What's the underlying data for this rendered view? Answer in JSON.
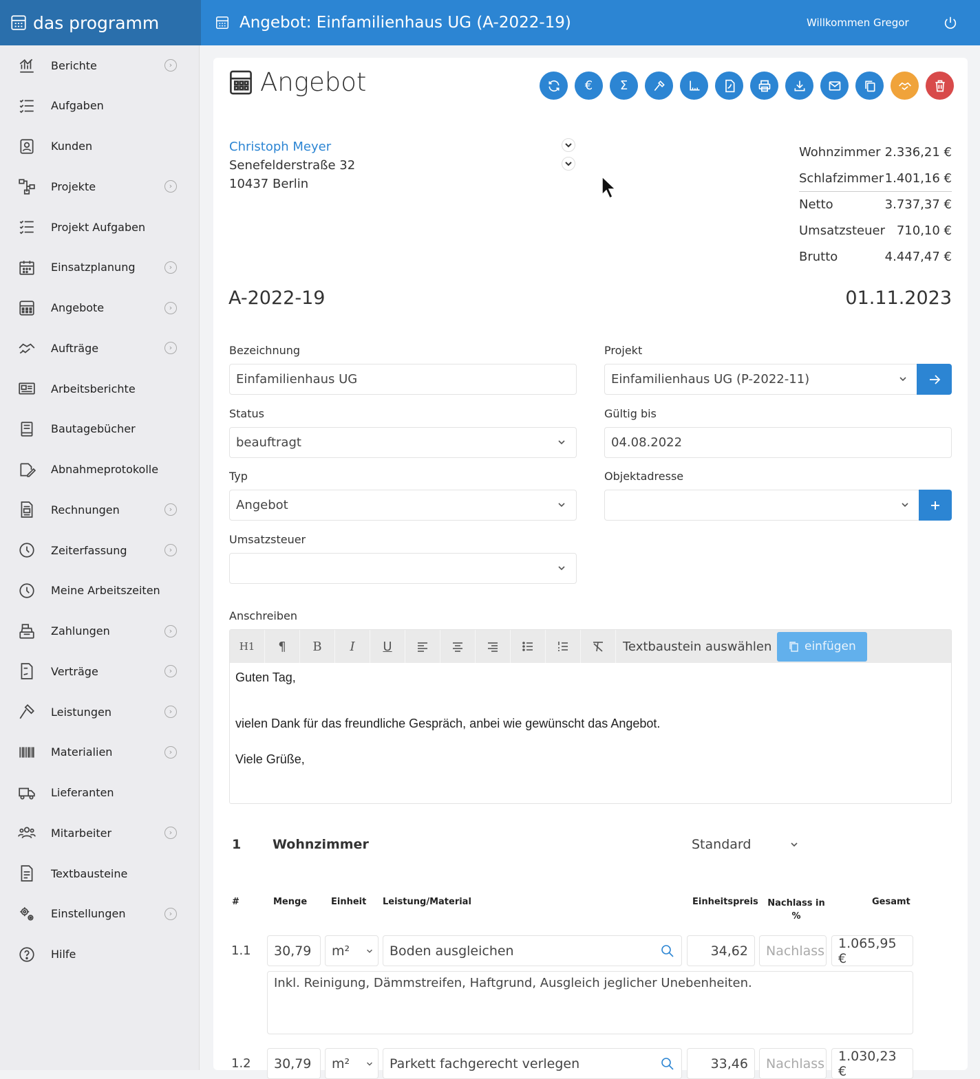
{
  "app": {
    "name": "das programm",
    "title": "Angebot: Einfamilienhaus UG (A-2022-19)",
    "welcome": "Willkommen Gregor"
  },
  "sidebar": {
    "items": [
      {
        "label": "Berichte",
        "icon": "chart-icon",
        "chevron": true
      },
      {
        "label": "Aufgaben",
        "icon": "tasks-icon",
        "chevron": false
      },
      {
        "label": "Kunden",
        "icon": "customer-icon",
        "chevron": false
      },
      {
        "label": "Projekte",
        "icon": "project-icon",
        "chevron": true
      },
      {
        "label": "Projekt Aufgaben",
        "icon": "tasks-icon",
        "chevron": false
      },
      {
        "label": "Einsatzplanung",
        "icon": "calendar-icon",
        "chevron": true
      },
      {
        "label": "Angebote",
        "icon": "calculator-icon",
        "chevron": true
      },
      {
        "label": "Aufträge",
        "icon": "handshake-icon",
        "chevron": true
      },
      {
        "label": "Arbeitsberichte",
        "icon": "newspaper-icon",
        "chevron": false
      },
      {
        "label": "Bautagebücher",
        "icon": "book-icon",
        "chevron": false
      },
      {
        "label": "Abnahmeprotokolle",
        "icon": "signature-icon",
        "chevron": false
      },
      {
        "label": "Rechnungen",
        "icon": "invoice-icon",
        "chevron": true
      },
      {
        "label": "Zeiterfassung",
        "icon": "clock-icon",
        "chevron": true
      },
      {
        "label": "Meine Arbeitszeiten",
        "icon": "clock-icon",
        "chevron": false
      },
      {
        "label": "Zahlungen",
        "icon": "cash-register-icon",
        "chevron": true
      },
      {
        "label": "Verträge",
        "icon": "contract-icon",
        "chevron": true
      },
      {
        "label": "Leistungen",
        "icon": "hammer-icon",
        "chevron": true
      },
      {
        "label": "Materialien",
        "icon": "barcode-icon",
        "chevron": true
      },
      {
        "label": "Lieferanten",
        "icon": "truck-icon",
        "chevron": false
      },
      {
        "label": "Mitarbeiter",
        "icon": "users-icon",
        "chevron": true
      },
      {
        "label": "Textbausteine",
        "icon": "file-text-icon",
        "chevron": false
      },
      {
        "label": "Einstellungen",
        "icon": "gears-icon",
        "chevron": true
      },
      {
        "label": "Hilfe",
        "icon": "help-icon",
        "chevron": false
      }
    ]
  },
  "page": {
    "heading": "Angebot"
  },
  "customer": {
    "name": "Christoph Meyer",
    "street": "Senefelderstraße 32",
    "city": "10437 Berlin"
  },
  "summary": [
    {
      "label": "Wohnzimmer",
      "value": "2.336,21 €"
    },
    {
      "label": "Schlafzimmer",
      "value": "1.401,16 €"
    },
    {
      "label": "Netto",
      "value": "3.737,37 €"
    },
    {
      "label": "Umsatzsteuer",
      "value": "710,10 €"
    },
    {
      "label": "Brutto",
      "value": "4.447,47 €"
    }
  ],
  "doc": {
    "number": "A-2022-19",
    "date": "01.11.2023"
  },
  "form": {
    "bezeichnung": {
      "label": "Bezeichnung",
      "value": "Einfamilienhaus UG"
    },
    "projekt": {
      "label": "Projekt",
      "value": "Einfamilienhaus UG (P-2022-11)"
    },
    "status": {
      "label": "Status",
      "value": "beauftragt"
    },
    "gueltig": {
      "label": "Gültig bis",
      "value": "04.08.2022"
    },
    "typ": {
      "label": "Typ",
      "value": "Angebot"
    },
    "objektadresse": {
      "label": "Objektadresse",
      "value": ""
    },
    "umsatzsteuer": {
      "label": "Umsatzsteuer",
      "value": ""
    }
  },
  "editor": {
    "label": "Anschreiben",
    "textbaustein_placeholder": "Textbaustein auswählen",
    "insert_label": "einfügen",
    "h1": "H1",
    "lines": [
      "Guten Tag,",
      "vielen Dank für das freundliche Gespräch, anbei wie gewünscht das Angebot.",
      "Viele Grüße,"
    ]
  },
  "section": {
    "number": "1",
    "title": "Wohnzimmer",
    "mode": "Standard"
  },
  "table": {
    "headers": {
      "no": "#",
      "menge": "Menge",
      "einheit": "Einheit",
      "leistung": "Leistung/Material",
      "einheitspreis": "Einheitspreis",
      "nachlass": "Nachlass in %",
      "gesamt": "Gesamt"
    },
    "rows": [
      {
        "no": "1.1",
        "menge": "30,79",
        "einheit": "m²",
        "leistung": "Boden ausgleichen",
        "einheitspreis": "34,62",
        "nachlass": "Nachlass",
        "gesamt": "1.065,95 €",
        "desc": "Inkl. Reinigung, Dämmstreifen, Haftgrund, Ausgleich jeglicher Unebenheiten."
      },
      {
        "no": "1.2",
        "menge": "30,79",
        "einheit": "m²",
        "leistung": "Parkett fachgerecht verlegen",
        "einheitspreis": "33,46",
        "nachlass": "Nachlass",
        "gesamt": "1.030,23 €"
      }
    ]
  },
  "colors": {
    "primary": "#2c85d3",
    "brand_dark": "#2a6fac",
    "orange": "#f0a33a",
    "red": "#d84a4a"
  }
}
